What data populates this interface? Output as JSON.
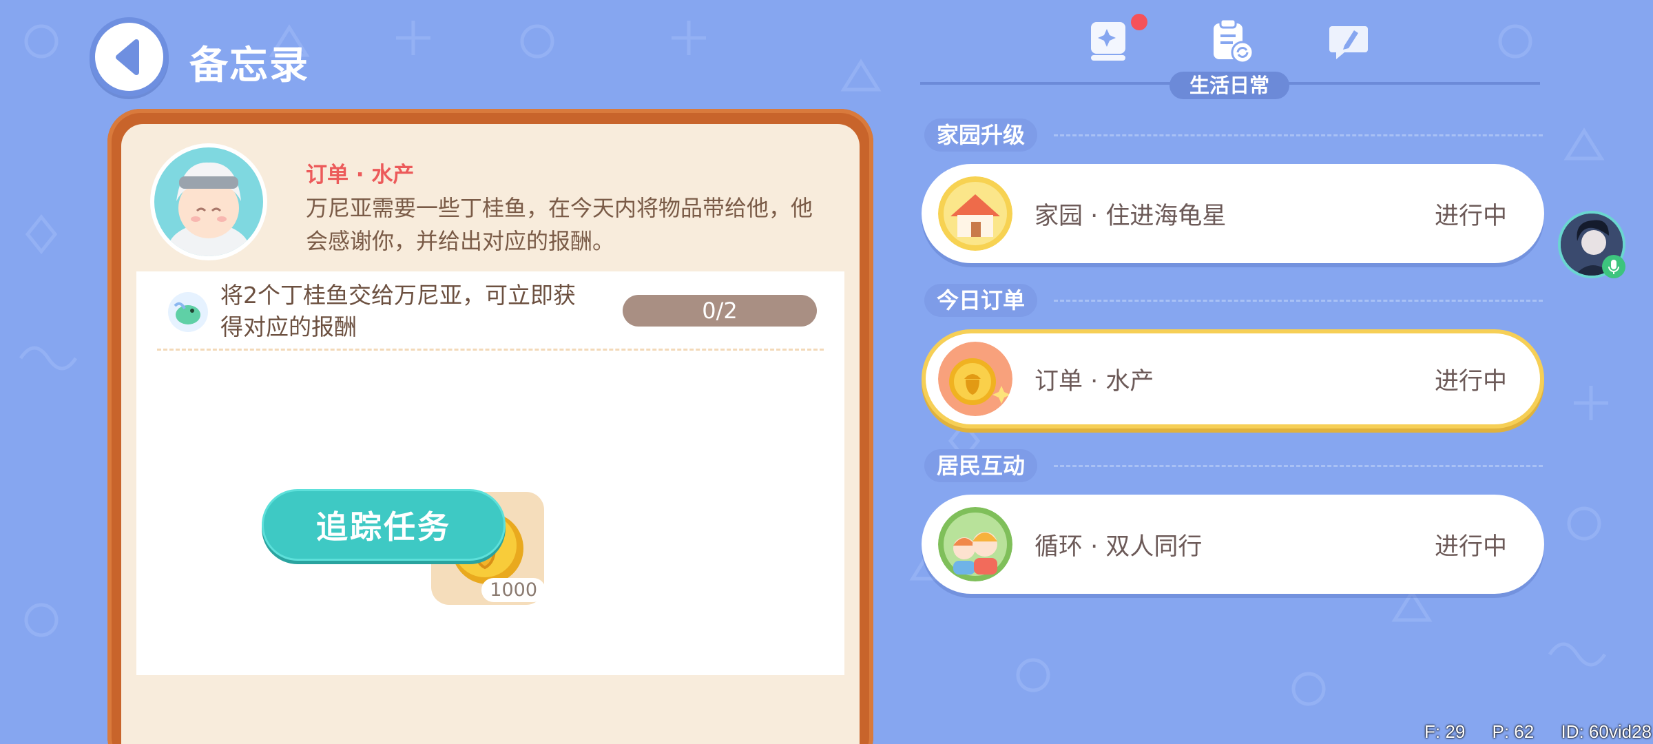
{
  "header": {
    "title": "备忘录"
  },
  "memo": {
    "order_title": "订单 · 水产",
    "description": "万尼亚需要一些丁桂鱼，在今天内将物品带给他，他会感谢你，并给出对应的报酬。",
    "task_text": "将2个丁桂鱼交给万尼亚，可立即获得对应的报酬",
    "progress_text": "0/2",
    "progress": {
      "current": 0,
      "total": 2
    },
    "reward_count": "1000",
    "track_button": "追踪任务"
  },
  "tabs": {
    "active_label": "生活日常",
    "icons": [
      "book-icon",
      "clipboard-refresh-icon",
      "speech-pencil-icon"
    ],
    "notification_dot": true
  },
  "sections": [
    {
      "heading": "家园升级",
      "card": {
        "name": "家园 · 住进海龟星",
        "status": "进行中",
        "icon": "house-icon",
        "active": false
      }
    },
    {
      "heading": "今日订单",
      "card": {
        "name": "订单 · 水产",
        "status": "进行中",
        "icon": "coin-order-icon",
        "active": true
      }
    },
    {
      "heading": "居民互动",
      "card": {
        "name": "循环 · 双人同行",
        "status": "进行中",
        "icon": "two-friends-icon",
        "active": false
      }
    }
  ],
  "debug": {
    "f": "F: 29",
    "p": "P: 62",
    "id": "ID: 60vid28"
  },
  "colors": {
    "background": "#86a6f0",
    "frame": "#c8642b",
    "order_title": "#ec5a5a",
    "track_button": "#3ec9c4",
    "active_border": "#f6cf56"
  }
}
